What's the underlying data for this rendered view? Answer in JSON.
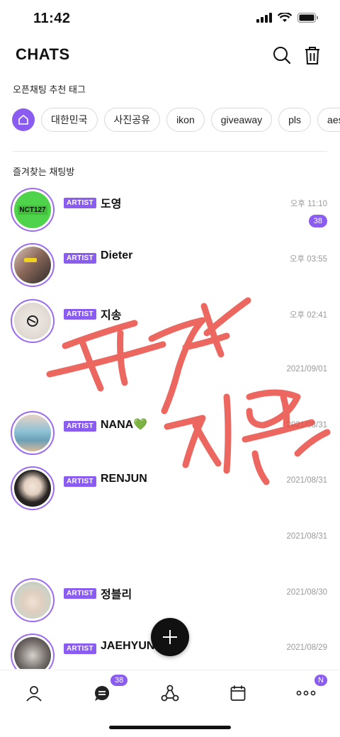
{
  "status": {
    "time": "11:42"
  },
  "header": {
    "title": "CHATS"
  },
  "tags_section": {
    "label": "오픈채팅 추천 태그"
  },
  "tags": [
    "대한민국",
    "사진공유",
    "ikon",
    "giveaway",
    "pls",
    "aesthetic"
  ],
  "favorites_section": {
    "label": "즐겨찾는 채팅방"
  },
  "chats": [
    {
      "badge": "ARTIST",
      "name": "도영",
      "time": "오후 11:10",
      "unread": "38",
      "avatar_color": "#4fd34a",
      "avatar_text": "NCT127"
    },
    {
      "badge": "ARTIST",
      "name": "Dieter",
      "time": "오후 03:55",
      "avatar_color": "#b89a8a"
    },
    {
      "badge": "ARTIST",
      "name": "지송",
      "time": "오후 02:41",
      "avatar_color": "#e8e2dc"
    },
    {
      "time": "2021/09/01"
    },
    {
      "badge": "ARTIST",
      "name": "NANA💚",
      "time": "2021/08/31",
      "avatar_color": "#7fb0c8"
    },
    {
      "badge": "ARTIST",
      "name": "RENJUN",
      "time": "2021/08/31",
      "avatar_color": "#3a3a3a"
    },
    {
      "time": "2021/08/31"
    },
    {
      "badge": "ARTIST",
      "name": "정블리",
      "time": "2021/08/30",
      "avatar_color": "#c8c8c0"
    },
    {
      "badge": "ARTIST",
      "name": "JAEHYUN",
      "time": "2021/08/29",
      "avatar_color": "#555555"
    }
  ],
  "tabbar": {
    "chat_badge": "38",
    "more_badge": "N"
  },
  "accent_color": "#8a5cf0"
}
